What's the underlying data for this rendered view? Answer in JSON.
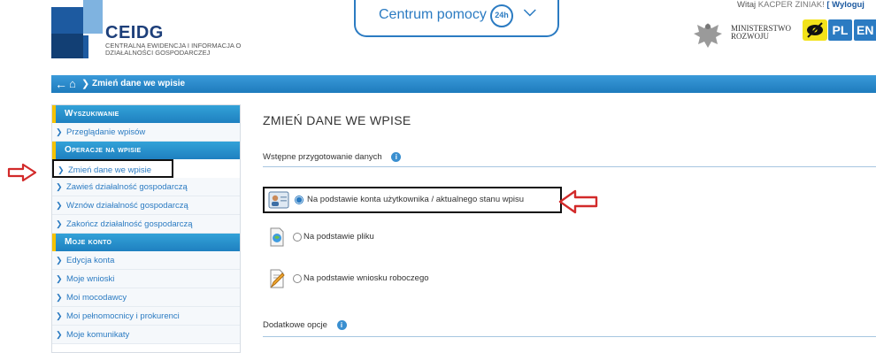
{
  "header": {
    "logo_title": "CEIDG",
    "logo_subtitle": "CENTRALNA EWIDENCJA I INFORMACJA O DZIAŁALNOŚCI GOSPODARCZEJ",
    "help_label": "Centrum pomocy",
    "help_badge": "24h",
    "welcome_prefix": "Witaj",
    "user_name": "KACPER ZINIAK!",
    "logout_label": "[ Wyloguj",
    "ministry_label": "MINISTERSTWO ROZWOJU",
    "lang_pl": "PL",
    "lang_en": "EN"
  },
  "breadcrumb": {
    "current": "Zmień dane we wpisie"
  },
  "sidebar": {
    "sections": [
      {
        "title": "Wyszukiwanie",
        "items": [
          {
            "label": "Przeglądanie wpisów",
            "active": false
          }
        ]
      },
      {
        "title": "Operacje na wpisie",
        "items": [
          {
            "label": "Zmień dane we wpisie",
            "active": true
          },
          {
            "label": "Zawieś działalność gospodarczą",
            "active": false
          },
          {
            "label": "Wznów działalność gospodarczą",
            "active": false
          },
          {
            "label": "Zakończ działalność gospodarczą",
            "active": false
          }
        ]
      },
      {
        "title": "Moje konto",
        "items": [
          {
            "label": "Edycja konta",
            "active": false
          },
          {
            "label": "Moje wnioski",
            "active": false
          },
          {
            "label": "Moi mocodawcy",
            "active": false
          },
          {
            "label": "Moi pełnomocnicy i prokurenci",
            "active": false
          },
          {
            "label": "Moje komunikaty",
            "active": false
          }
        ]
      }
    ]
  },
  "main": {
    "title": "ZMIEŃ DANE WE WPISE",
    "prep_section_label": "Wstępne przygotowanie danych",
    "options": [
      {
        "label": "Na podstawie konta użytkownika / aktualnego stanu wpisu",
        "checked": true,
        "icon": "user-card-icon"
      },
      {
        "label": "Na podstawie pliku",
        "checked": false,
        "icon": "file-globe-icon"
      },
      {
        "label": "Na podstawie wniosku roboczego",
        "checked": false,
        "icon": "draft-edit-icon"
      }
    ],
    "extra_section_label": "Dodatkowe opcje"
  },
  "colors": {
    "brand_blue": "#2b7bc2",
    "sidebar_accent": "#f5c200",
    "annotation_red": "#d22a2a"
  }
}
